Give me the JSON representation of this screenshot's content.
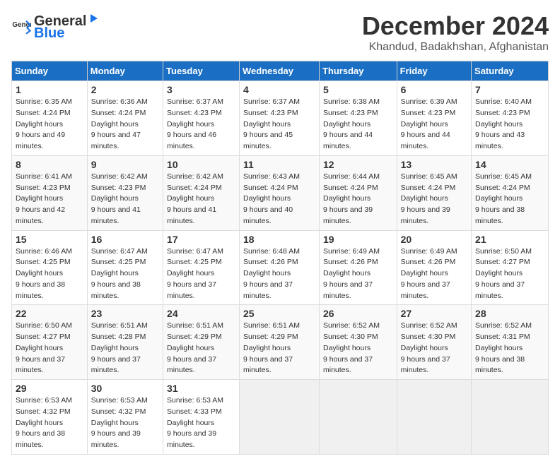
{
  "logo": {
    "general": "General",
    "blue": "Blue"
  },
  "title": "December 2024",
  "subtitle": "Khandud, Badakhshan, Afghanistan",
  "days_header": [
    "Sunday",
    "Monday",
    "Tuesday",
    "Wednesday",
    "Thursday",
    "Friday",
    "Saturday"
  ],
  "weeks": [
    [
      {
        "day": "1",
        "sunrise": "6:35 AM",
        "sunset": "4:24 PM",
        "daylight": "9 hours and 49 minutes."
      },
      {
        "day": "2",
        "sunrise": "6:36 AM",
        "sunset": "4:24 PM",
        "daylight": "9 hours and 47 minutes."
      },
      {
        "day": "3",
        "sunrise": "6:37 AM",
        "sunset": "4:23 PM",
        "daylight": "9 hours and 46 minutes."
      },
      {
        "day": "4",
        "sunrise": "6:37 AM",
        "sunset": "4:23 PM",
        "daylight": "9 hours and 45 minutes."
      },
      {
        "day": "5",
        "sunrise": "6:38 AM",
        "sunset": "4:23 PM",
        "daylight": "9 hours and 44 minutes."
      },
      {
        "day": "6",
        "sunrise": "6:39 AM",
        "sunset": "4:23 PM",
        "daylight": "9 hours and 44 minutes."
      },
      {
        "day": "7",
        "sunrise": "6:40 AM",
        "sunset": "4:23 PM",
        "daylight": "9 hours and 43 minutes."
      }
    ],
    [
      {
        "day": "8",
        "sunrise": "6:41 AM",
        "sunset": "4:23 PM",
        "daylight": "9 hours and 42 minutes."
      },
      {
        "day": "9",
        "sunrise": "6:42 AM",
        "sunset": "4:23 PM",
        "daylight": "9 hours and 41 minutes."
      },
      {
        "day": "10",
        "sunrise": "6:42 AM",
        "sunset": "4:24 PM",
        "daylight": "9 hours and 41 minutes."
      },
      {
        "day": "11",
        "sunrise": "6:43 AM",
        "sunset": "4:24 PM",
        "daylight": "9 hours and 40 minutes."
      },
      {
        "day": "12",
        "sunrise": "6:44 AM",
        "sunset": "4:24 PM",
        "daylight": "9 hours and 39 minutes."
      },
      {
        "day": "13",
        "sunrise": "6:45 AM",
        "sunset": "4:24 PM",
        "daylight": "9 hours and 39 minutes."
      },
      {
        "day": "14",
        "sunrise": "6:45 AM",
        "sunset": "4:24 PM",
        "daylight": "9 hours and 38 minutes."
      }
    ],
    [
      {
        "day": "15",
        "sunrise": "6:46 AM",
        "sunset": "4:25 PM",
        "daylight": "9 hours and 38 minutes."
      },
      {
        "day": "16",
        "sunrise": "6:47 AM",
        "sunset": "4:25 PM",
        "daylight": "9 hours and 38 minutes."
      },
      {
        "day": "17",
        "sunrise": "6:47 AM",
        "sunset": "4:25 PM",
        "daylight": "9 hours and 37 minutes."
      },
      {
        "day": "18",
        "sunrise": "6:48 AM",
        "sunset": "4:26 PM",
        "daylight": "9 hours and 37 minutes."
      },
      {
        "day": "19",
        "sunrise": "6:49 AM",
        "sunset": "4:26 PM",
        "daylight": "9 hours and 37 minutes."
      },
      {
        "day": "20",
        "sunrise": "6:49 AM",
        "sunset": "4:26 PM",
        "daylight": "9 hours and 37 minutes."
      },
      {
        "day": "21",
        "sunrise": "6:50 AM",
        "sunset": "4:27 PM",
        "daylight": "9 hours and 37 minutes."
      }
    ],
    [
      {
        "day": "22",
        "sunrise": "6:50 AM",
        "sunset": "4:27 PM",
        "daylight": "9 hours and 37 minutes."
      },
      {
        "day": "23",
        "sunrise": "6:51 AM",
        "sunset": "4:28 PM",
        "daylight": "9 hours and 37 minutes."
      },
      {
        "day": "24",
        "sunrise": "6:51 AM",
        "sunset": "4:29 PM",
        "daylight": "9 hours and 37 minutes."
      },
      {
        "day": "25",
        "sunrise": "6:51 AM",
        "sunset": "4:29 PM",
        "daylight": "9 hours and 37 minutes."
      },
      {
        "day": "26",
        "sunrise": "6:52 AM",
        "sunset": "4:30 PM",
        "daylight": "9 hours and 37 minutes."
      },
      {
        "day": "27",
        "sunrise": "6:52 AM",
        "sunset": "4:30 PM",
        "daylight": "9 hours and 37 minutes."
      },
      {
        "day": "28",
        "sunrise": "6:52 AM",
        "sunset": "4:31 PM",
        "daylight": "9 hours and 38 minutes."
      }
    ],
    [
      {
        "day": "29",
        "sunrise": "6:53 AM",
        "sunset": "4:32 PM",
        "daylight": "9 hours and 38 minutes."
      },
      {
        "day": "30",
        "sunrise": "6:53 AM",
        "sunset": "4:32 PM",
        "daylight": "9 hours and 39 minutes."
      },
      {
        "day": "31",
        "sunrise": "6:53 AM",
        "sunset": "4:33 PM",
        "daylight": "9 hours and 39 minutes."
      },
      null,
      null,
      null,
      null
    ]
  ]
}
